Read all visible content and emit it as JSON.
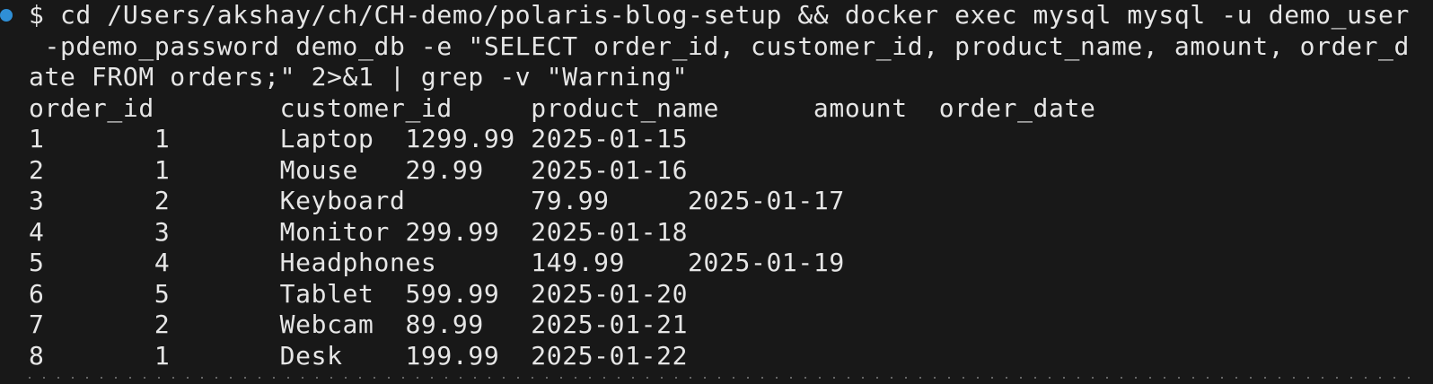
{
  "terminal": {
    "status_dot_color": "#2f8fd6",
    "command_lines": [
      "$ cd /Users/akshay/ch/CH-demo/polaris-blog-setup && docker exec mysql mysql -u demo_user",
      " -pdemo_password demo_db -e \"SELECT order_id, customer_id, product_name, amount, order_d",
      "ate FROM orders;\" 2>&1 | grep -v \"Warning\""
    ],
    "output_lines": [
      "order_id        customer_id     product_name      amount  order_date",
      "1       1       Laptop  1299.99 2025-01-15",
      "2       1       Mouse   29.99   2025-01-16",
      "3       2       Keyboard        79.99     2025-01-17",
      "4       3       Monitor 299.99  2025-01-18",
      "5       4       Headphones      149.99    2025-01-19",
      "6       5       Tablet  599.99  2025-01-20",
      "7       2       Webcam  89.99   2025-01-21",
      "8       1       Desk    199.99  2025-01-22"
    ]
  }
}
